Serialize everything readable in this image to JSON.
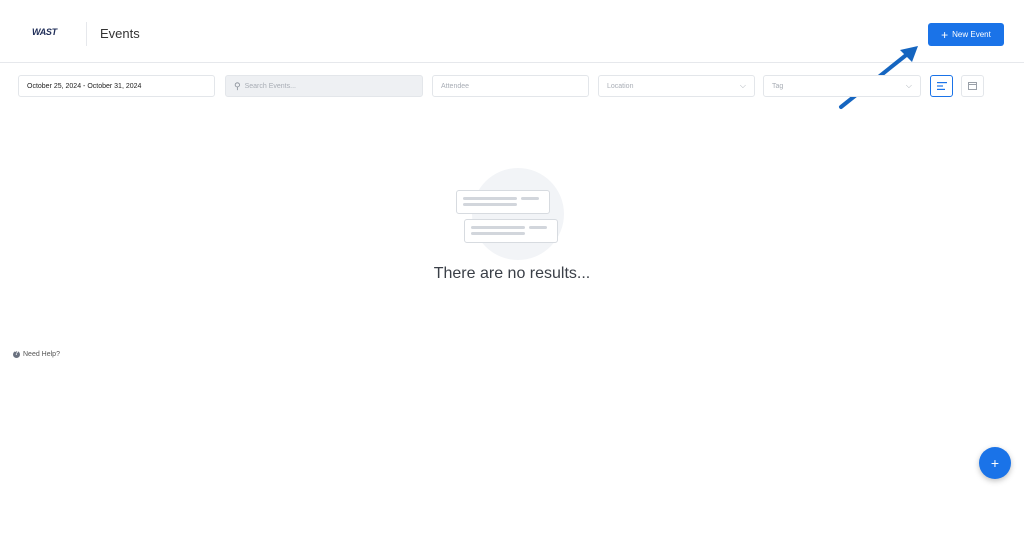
{
  "header": {
    "logo_text": "WAST",
    "title": "Events",
    "new_event_label": "New Event"
  },
  "filters": {
    "date_range": "October 25, 2024 - October 31, 2024",
    "search_placeholder": "Search Events...",
    "attendee_placeholder": "Attendee",
    "location_placeholder": "Location",
    "tag_placeholder": "Tag"
  },
  "empty_state": {
    "message": "There are no results..."
  },
  "footer": {
    "help_label": "Need Help?"
  },
  "icons": {
    "search": "search-icon",
    "chevron": "chevron-down-icon",
    "list_view": "list-view-icon",
    "calendar_view": "calendar-icon",
    "fab": "plus-icon"
  },
  "colors": {
    "accent": "#1a73e8",
    "annotation_arrow": "#1565c0"
  }
}
